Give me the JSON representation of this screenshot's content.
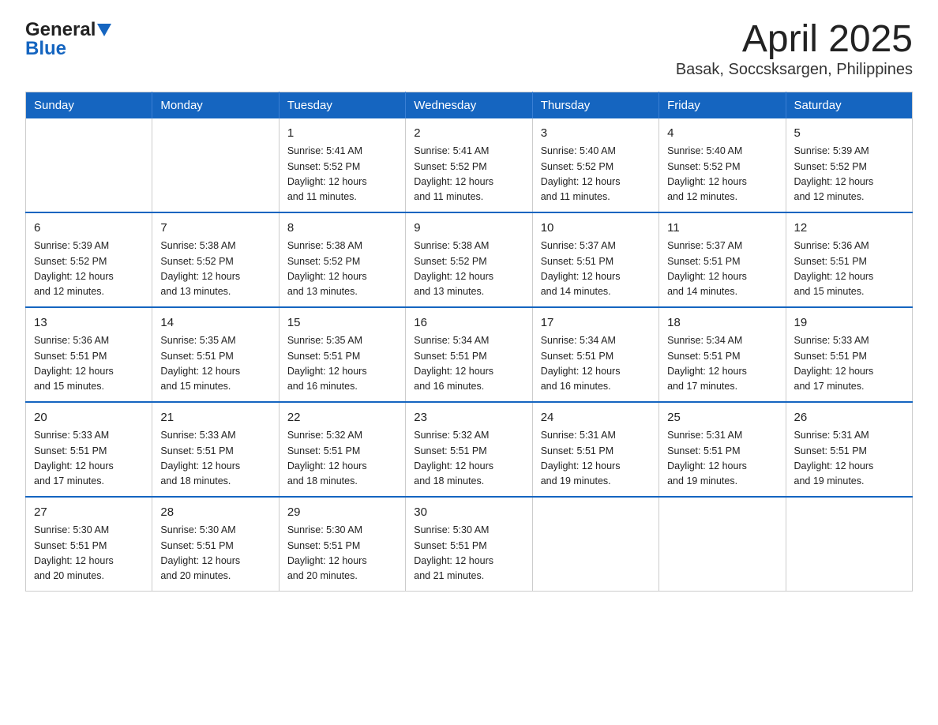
{
  "header": {
    "logo_general": "General",
    "logo_blue": "Blue",
    "title": "April 2025",
    "subtitle": "Basak, Soccsksargen, Philippines"
  },
  "weekdays": [
    "Sunday",
    "Monday",
    "Tuesday",
    "Wednesday",
    "Thursday",
    "Friday",
    "Saturday"
  ],
  "weeks": [
    [
      {
        "day": "",
        "info": ""
      },
      {
        "day": "",
        "info": ""
      },
      {
        "day": "1",
        "info": "Sunrise: 5:41 AM\nSunset: 5:52 PM\nDaylight: 12 hours\nand 11 minutes."
      },
      {
        "day": "2",
        "info": "Sunrise: 5:41 AM\nSunset: 5:52 PM\nDaylight: 12 hours\nand 11 minutes."
      },
      {
        "day": "3",
        "info": "Sunrise: 5:40 AM\nSunset: 5:52 PM\nDaylight: 12 hours\nand 11 minutes."
      },
      {
        "day": "4",
        "info": "Sunrise: 5:40 AM\nSunset: 5:52 PM\nDaylight: 12 hours\nand 12 minutes."
      },
      {
        "day": "5",
        "info": "Sunrise: 5:39 AM\nSunset: 5:52 PM\nDaylight: 12 hours\nand 12 minutes."
      }
    ],
    [
      {
        "day": "6",
        "info": "Sunrise: 5:39 AM\nSunset: 5:52 PM\nDaylight: 12 hours\nand 12 minutes."
      },
      {
        "day": "7",
        "info": "Sunrise: 5:38 AM\nSunset: 5:52 PM\nDaylight: 12 hours\nand 13 minutes."
      },
      {
        "day": "8",
        "info": "Sunrise: 5:38 AM\nSunset: 5:52 PM\nDaylight: 12 hours\nand 13 minutes."
      },
      {
        "day": "9",
        "info": "Sunrise: 5:38 AM\nSunset: 5:52 PM\nDaylight: 12 hours\nand 13 minutes."
      },
      {
        "day": "10",
        "info": "Sunrise: 5:37 AM\nSunset: 5:51 PM\nDaylight: 12 hours\nand 14 minutes."
      },
      {
        "day": "11",
        "info": "Sunrise: 5:37 AM\nSunset: 5:51 PM\nDaylight: 12 hours\nand 14 minutes."
      },
      {
        "day": "12",
        "info": "Sunrise: 5:36 AM\nSunset: 5:51 PM\nDaylight: 12 hours\nand 15 minutes."
      }
    ],
    [
      {
        "day": "13",
        "info": "Sunrise: 5:36 AM\nSunset: 5:51 PM\nDaylight: 12 hours\nand 15 minutes."
      },
      {
        "day": "14",
        "info": "Sunrise: 5:35 AM\nSunset: 5:51 PM\nDaylight: 12 hours\nand 15 minutes."
      },
      {
        "day": "15",
        "info": "Sunrise: 5:35 AM\nSunset: 5:51 PM\nDaylight: 12 hours\nand 16 minutes."
      },
      {
        "day": "16",
        "info": "Sunrise: 5:34 AM\nSunset: 5:51 PM\nDaylight: 12 hours\nand 16 minutes."
      },
      {
        "day": "17",
        "info": "Sunrise: 5:34 AM\nSunset: 5:51 PM\nDaylight: 12 hours\nand 16 minutes."
      },
      {
        "day": "18",
        "info": "Sunrise: 5:34 AM\nSunset: 5:51 PM\nDaylight: 12 hours\nand 17 minutes."
      },
      {
        "day": "19",
        "info": "Sunrise: 5:33 AM\nSunset: 5:51 PM\nDaylight: 12 hours\nand 17 minutes."
      }
    ],
    [
      {
        "day": "20",
        "info": "Sunrise: 5:33 AM\nSunset: 5:51 PM\nDaylight: 12 hours\nand 17 minutes."
      },
      {
        "day": "21",
        "info": "Sunrise: 5:33 AM\nSunset: 5:51 PM\nDaylight: 12 hours\nand 18 minutes."
      },
      {
        "day": "22",
        "info": "Sunrise: 5:32 AM\nSunset: 5:51 PM\nDaylight: 12 hours\nand 18 minutes."
      },
      {
        "day": "23",
        "info": "Sunrise: 5:32 AM\nSunset: 5:51 PM\nDaylight: 12 hours\nand 18 minutes."
      },
      {
        "day": "24",
        "info": "Sunrise: 5:31 AM\nSunset: 5:51 PM\nDaylight: 12 hours\nand 19 minutes."
      },
      {
        "day": "25",
        "info": "Sunrise: 5:31 AM\nSunset: 5:51 PM\nDaylight: 12 hours\nand 19 minutes."
      },
      {
        "day": "26",
        "info": "Sunrise: 5:31 AM\nSunset: 5:51 PM\nDaylight: 12 hours\nand 19 minutes."
      }
    ],
    [
      {
        "day": "27",
        "info": "Sunrise: 5:30 AM\nSunset: 5:51 PM\nDaylight: 12 hours\nand 20 minutes."
      },
      {
        "day": "28",
        "info": "Sunrise: 5:30 AM\nSunset: 5:51 PM\nDaylight: 12 hours\nand 20 minutes."
      },
      {
        "day": "29",
        "info": "Sunrise: 5:30 AM\nSunset: 5:51 PM\nDaylight: 12 hours\nand 20 minutes."
      },
      {
        "day": "30",
        "info": "Sunrise: 5:30 AM\nSunset: 5:51 PM\nDaylight: 12 hours\nand 21 minutes."
      },
      {
        "day": "",
        "info": ""
      },
      {
        "day": "",
        "info": ""
      },
      {
        "day": "",
        "info": ""
      }
    ]
  ]
}
